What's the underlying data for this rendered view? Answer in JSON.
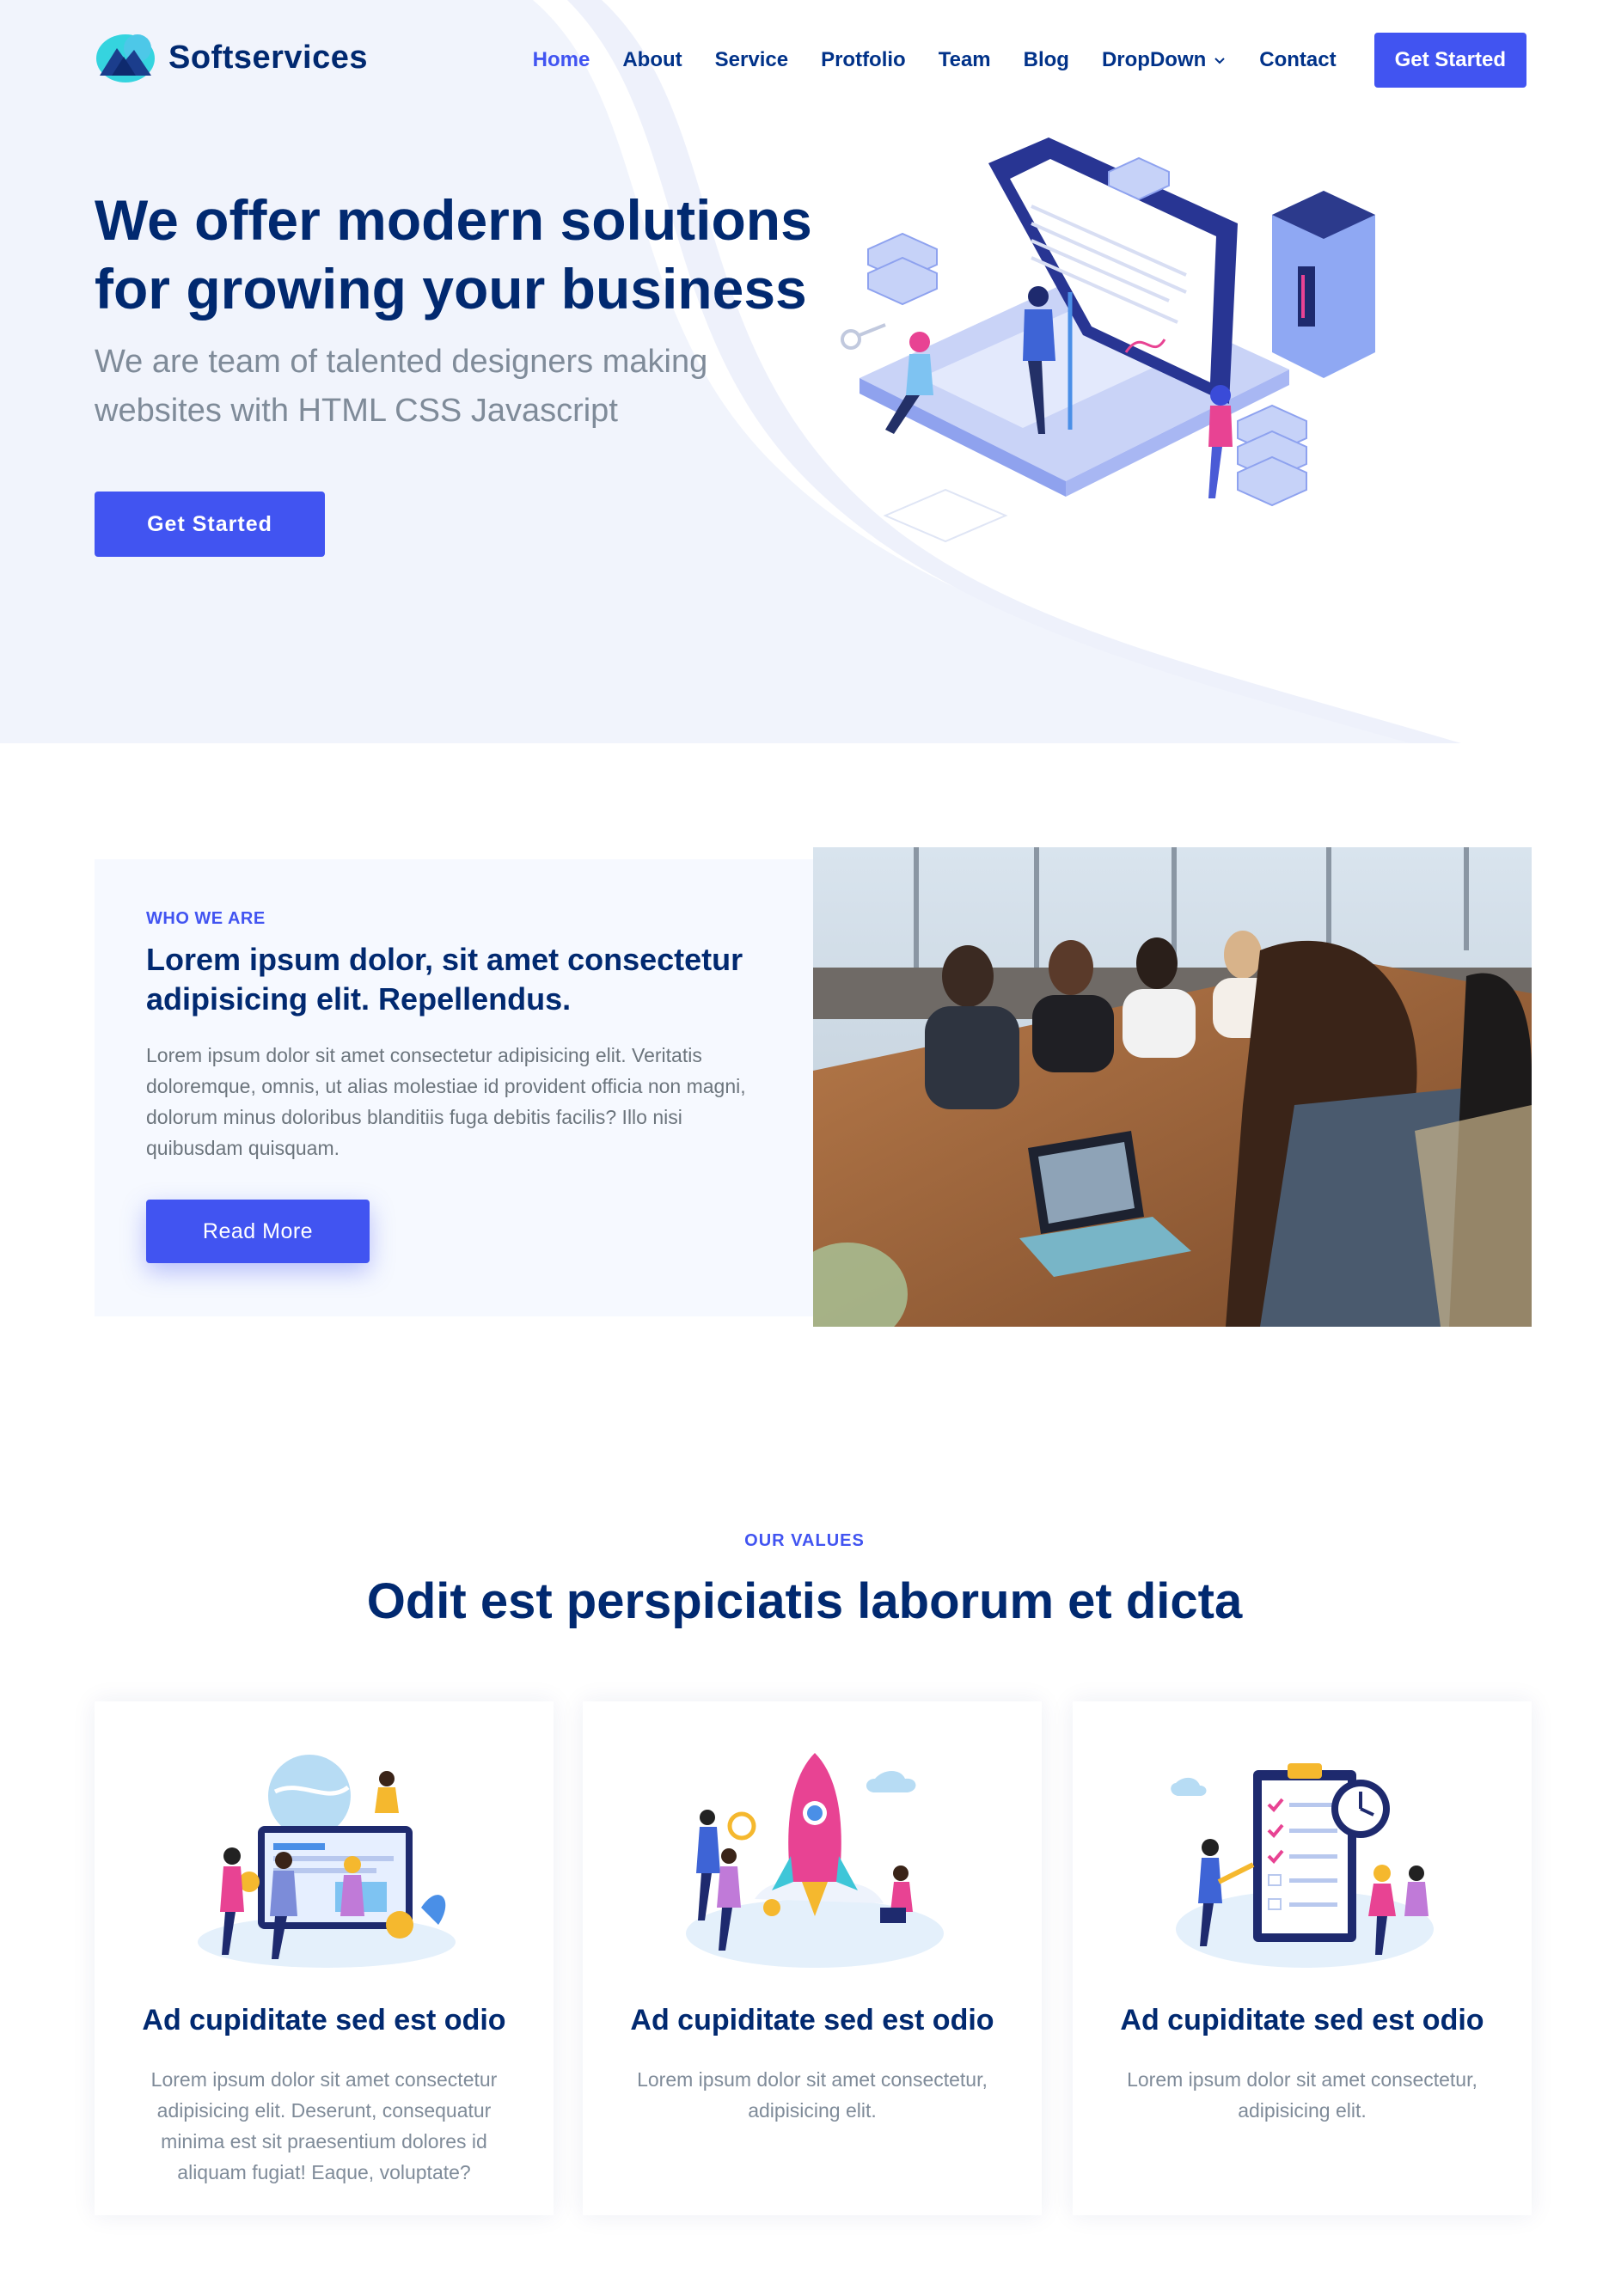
{
  "brand": {
    "name": "Softservices",
    "accent": "#4154f1",
    "navy": "#012970"
  },
  "nav": {
    "items": [
      {
        "label": "Home",
        "active": true
      },
      {
        "label": "About"
      },
      {
        "label": "Service"
      },
      {
        "label": "Protfolio"
      },
      {
        "label": "Team"
      },
      {
        "label": "Blog"
      },
      {
        "label": "DropDown",
        "dropdown": true
      },
      {
        "label": "Contact"
      }
    ],
    "cta": "Get Started"
  },
  "hero": {
    "title": "We offer modern solutions for growing your business",
    "subtitle": "We are team of talented designers making websites with HTML CSS Javascript",
    "button": "Get Started"
  },
  "about": {
    "eyebrow": "WHO WE ARE",
    "title": "Lorem ipsum dolor, sit amet consectetur adipisicing elit. Repellendus.",
    "text": "Lorem ipsum dolor sit amet consectetur adipisicing elit. Veritatis doloremque, omnis, ut alias molestiae id provident officia non magni, dolorum minus doloribus blanditiis fuga debitis facilis? Illo nisi quibusdam quisquam.",
    "button": "Read More"
  },
  "values": {
    "eyebrow": "OUR VALUES",
    "title": "Odit est perspiciatis laborum et dicta",
    "cards": [
      {
        "title": "Ad cupiditate sed est odio",
        "text": "Lorem ipsum dolor sit amet consectetur adipisicing elit. Deserunt, consequatur minima est sit praesentium dolores id aliquam fugiat! Eaque, voluptate?",
        "icon": "dashboard-team-illustration"
      },
      {
        "title": "Ad cupiditate sed est odio",
        "text": "Lorem ipsum dolor sit amet consectetur, adipisicing elit.",
        "icon": "rocket-launch-illustration"
      },
      {
        "title": "Ad cupiditate sed est odio",
        "text": "Lorem ipsum dolor sit amet consectetur, adipisicing elit.",
        "icon": "checklist-clock-illustration"
      }
    ]
  }
}
